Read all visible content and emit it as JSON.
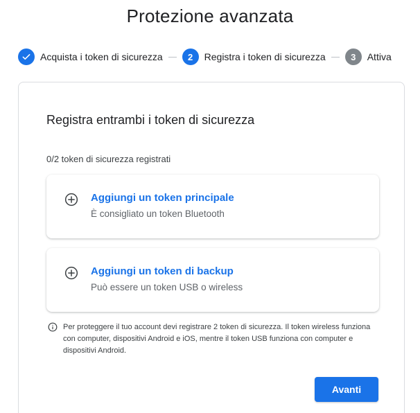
{
  "page": {
    "title": "Protezione avanzata"
  },
  "stepper": {
    "steps": [
      {
        "number": "",
        "label": "Acquista i token di sicurezza",
        "state": "done",
        "icon": "check-icon"
      },
      {
        "number": "2",
        "label": "Registra i token di sicurezza",
        "state": "active"
      },
      {
        "number": "3",
        "label": "Attiva",
        "state": "pending"
      }
    ]
  },
  "card": {
    "heading": "Registra entrambi i token di sicurezza",
    "count": "0/2 token di sicurezza registrati",
    "options": [
      {
        "title": "Aggiungi un token principale",
        "subtitle": "È consigliato un token Bluetooth",
        "icon": "add-circle-icon"
      },
      {
        "title": "Aggiungi un token di backup",
        "subtitle": "Può essere un token USB o wireless",
        "icon": "add-circle-icon"
      }
    ],
    "note": "Per proteggere il tuo account devi registrare 2 token di sicurezza. Il token wireless funziona con computer, dispositivi Android e iOS, mentre il token USB funziona con computer e dispositivi Android.",
    "note_icon": "info-icon",
    "next_label": "Avanti"
  },
  "colors": {
    "accent": "#1a73e8",
    "pending": "#80868b",
    "border": "#dadce0"
  }
}
